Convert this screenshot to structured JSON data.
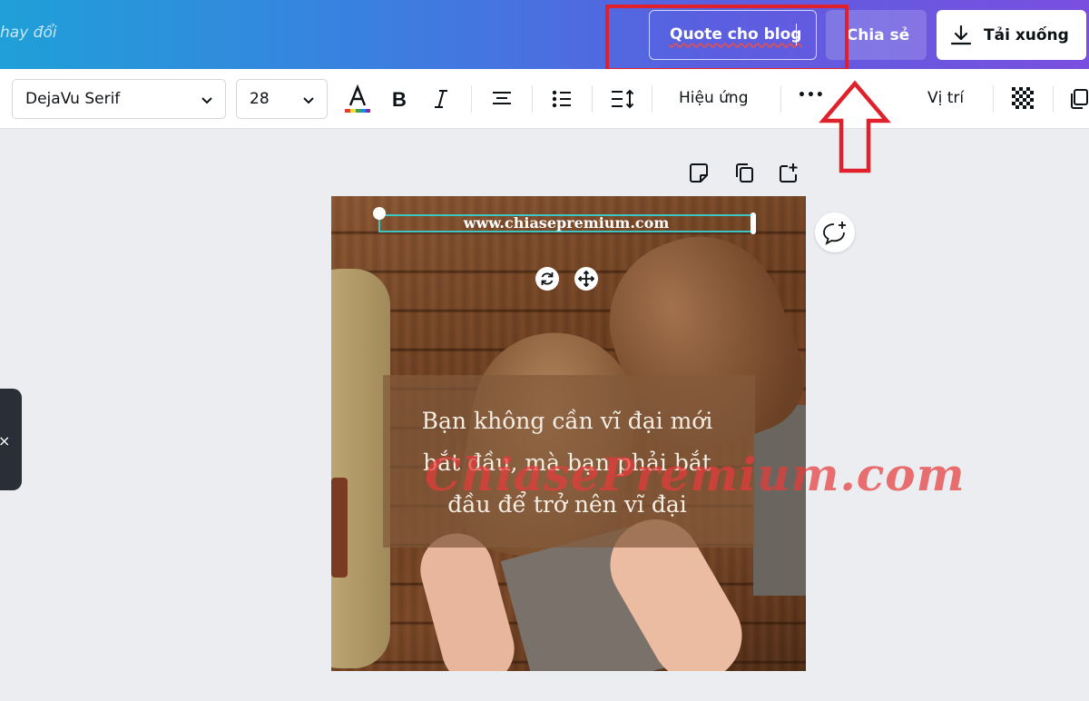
{
  "header": {
    "unsaved_text": "hay đổi",
    "design_title": "Quote cho blog",
    "share_label": "Chia sẻ",
    "download_label": "Tải xuống"
  },
  "toolbar": {
    "font_family": "DejaVu Serif",
    "font_size": "28",
    "effects_label": "Hiệu ứng",
    "more_label": "•••",
    "position_label": "Vị trí"
  },
  "canvas": {
    "site_text": "www.chiasepremium.com",
    "quote_line1": "Bạn không cần vĩ đại mới",
    "quote_line2": "bắt đầu, mà bạn phải bắt",
    "quote_line3": "đầu để trở nên vĩ đại"
  },
  "watermark": "ChiasePremium.com",
  "colors": {
    "highlight": "#e0202a",
    "text_selection": "#3dc6c4"
  }
}
